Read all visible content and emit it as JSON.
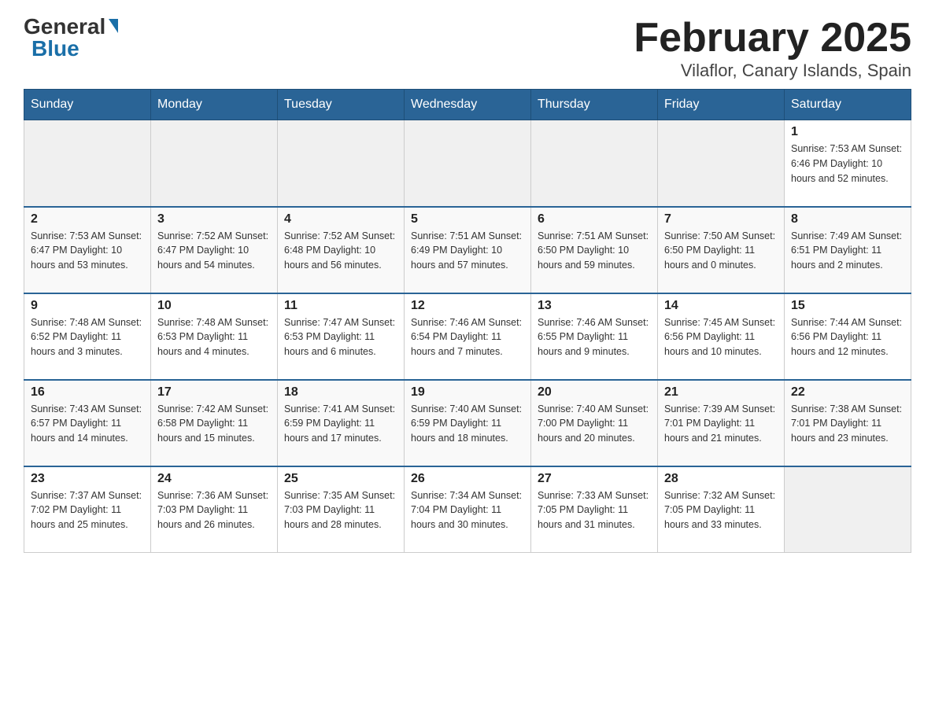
{
  "logo": {
    "general": "General",
    "blue": "Blue",
    "triangle_color": "#1a6fa8"
  },
  "header": {
    "title": "February 2025",
    "subtitle": "Vilaflor, Canary Islands, Spain"
  },
  "days_of_week": [
    "Sunday",
    "Monday",
    "Tuesday",
    "Wednesday",
    "Thursday",
    "Friday",
    "Saturday"
  ],
  "weeks": [
    {
      "days": [
        {
          "num": "",
          "info": ""
        },
        {
          "num": "",
          "info": ""
        },
        {
          "num": "",
          "info": ""
        },
        {
          "num": "",
          "info": ""
        },
        {
          "num": "",
          "info": ""
        },
        {
          "num": "",
          "info": ""
        },
        {
          "num": "1",
          "info": "Sunrise: 7:53 AM\nSunset: 6:46 PM\nDaylight: 10 hours\nand 52 minutes."
        }
      ]
    },
    {
      "days": [
        {
          "num": "2",
          "info": "Sunrise: 7:53 AM\nSunset: 6:47 PM\nDaylight: 10 hours\nand 53 minutes."
        },
        {
          "num": "3",
          "info": "Sunrise: 7:52 AM\nSunset: 6:47 PM\nDaylight: 10 hours\nand 54 minutes."
        },
        {
          "num": "4",
          "info": "Sunrise: 7:52 AM\nSunset: 6:48 PM\nDaylight: 10 hours\nand 56 minutes."
        },
        {
          "num": "5",
          "info": "Sunrise: 7:51 AM\nSunset: 6:49 PM\nDaylight: 10 hours\nand 57 minutes."
        },
        {
          "num": "6",
          "info": "Sunrise: 7:51 AM\nSunset: 6:50 PM\nDaylight: 10 hours\nand 59 minutes."
        },
        {
          "num": "7",
          "info": "Sunrise: 7:50 AM\nSunset: 6:50 PM\nDaylight: 11 hours\nand 0 minutes."
        },
        {
          "num": "8",
          "info": "Sunrise: 7:49 AM\nSunset: 6:51 PM\nDaylight: 11 hours\nand 2 minutes."
        }
      ]
    },
    {
      "days": [
        {
          "num": "9",
          "info": "Sunrise: 7:48 AM\nSunset: 6:52 PM\nDaylight: 11 hours\nand 3 minutes."
        },
        {
          "num": "10",
          "info": "Sunrise: 7:48 AM\nSunset: 6:53 PM\nDaylight: 11 hours\nand 4 minutes."
        },
        {
          "num": "11",
          "info": "Sunrise: 7:47 AM\nSunset: 6:53 PM\nDaylight: 11 hours\nand 6 minutes."
        },
        {
          "num": "12",
          "info": "Sunrise: 7:46 AM\nSunset: 6:54 PM\nDaylight: 11 hours\nand 7 minutes."
        },
        {
          "num": "13",
          "info": "Sunrise: 7:46 AM\nSunset: 6:55 PM\nDaylight: 11 hours\nand 9 minutes."
        },
        {
          "num": "14",
          "info": "Sunrise: 7:45 AM\nSunset: 6:56 PM\nDaylight: 11 hours\nand 10 minutes."
        },
        {
          "num": "15",
          "info": "Sunrise: 7:44 AM\nSunset: 6:56 PM\nDaylight: 11 hours\nand 12 minutes."
        }
      ]
    },
    {
      "days": [
        {
          "num": "16",
          "info": "Sunrise: 7:43 AM\nSunset: 6:57 PM\nDaylight: 11 hours\nand 14 minutes."
        },
        {
          "num": "17",
          "info": "Sunrise: 7:42 AM\nSunset: 6:58 PM\nDaylight: 11 hours\nand 15 minutes."
        },
        {
          "num": "18",
          "info": "Sunrise: 7:41 AM\nSunset: 6:59 PM\nDaylight: 11 hours\nand 17 minutes."
        },
        {
          "num": "19",
          "info": "Sunrise: 7:40 AM\nSunset: 6:59 PM\nDaylight: 11 hours\nand 18 minutes."
        },
        {
          "num": "20",
          "info": "Sunrise: 7:40 AM\nSunset: 7:00 PM\nDaylight: 11 hours\nand 20 minutes."
        },
        {
          "num": "21",
          "info": "Sunrise: 7:39 AM\nSunset: 7:01 PM\nDaylight: 11 hours\nand 21 minutes."
        },
        {
          "num": "22",
          "info": "Sunrise: 7:38 AM\nSunset: 7:01 PM\nDaylight: 11 hours\nand 23 minutes."
        }
      ]
    },
    {
      "days": [
        {
          "num": "23",
          "info": "Sunrise: 7:37 AM\nSunset: 7:02 PM\nDaylight: 11 hours\nand 25 minutes."
        },
        {
          "num": "24",
          "info": "Sunrise: 7:36 AM\nSunset: 7:03 PM\nDaylight: 11 hours\nand 26 minutes."
        },
        {
          "num": "25",
          "info": "Sunrise: 7:35 AM\nSunset: 7:03 PM\nDaylight: 11 hours\nand 28 minutes."
        },
        {
          "num": "26",
          "info": "Sunrise: 7:34 AM\nSunset: 7:04 PM\nDaylight: 11 hours\nand 30 minutes."
        },
        {
          "num": "27",
          "info": "Sunrise: 7:33 AM\nSunset: 7:05 PM\nDaylight: 11 hours\nand 31 minutes."
        },
        {
          "num": "28",
          "info": "Sunrise: 7:32 AM\nSunset: 7:05 PM\nDaylight: 11 hours\nand 33 minutes."
        },
        {
          "num": "",
          "info": ""
        }
      ]
    }
  ]
}
